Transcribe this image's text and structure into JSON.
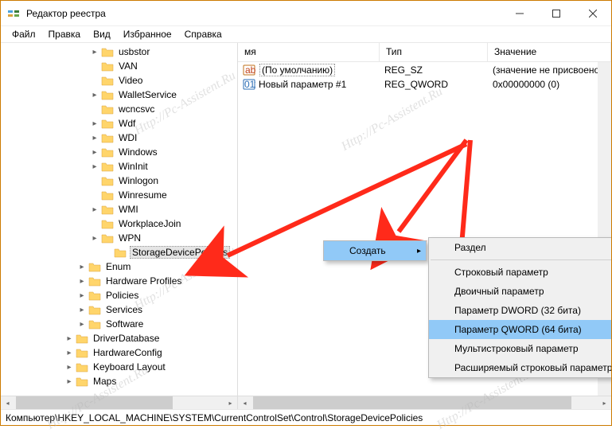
{
  "window": {
    "title": "Редактор реестра"
  },
  "menu": {
    "file": "Файл",
    "edit": "Правка",
    "view": "Вид",
    "favorites": "Избранное",
    "help": "Справка"
  },
  "tree": {
    "items": [
      {
        "indent": 7,
        "exp": "▸",
        "label": "usbstor"
      },
      {
        "indent": 7,
        "exp": "",
        "label": "VAN"
      },
      {
        "indent": 7,
        "exp": "",
        "label": "Video"
      },
      {
        "indent": 7,
        "exp": "▸",
        "label": "WalletService"
      },
      {
        "indent": 7,
        "exp": "",
        "label": "wcncsvc"
      },
      {
        "indent": 7,
        "exp": "▸",
        "label": "Wdf"
      },
      {
        "indent": 7,
        "exp": "▸",
        "label": "WDI"
      },
      {
        "indent": 7,
        "exp": "▸",
        "label": "Windows"
      },
      {
        "indent": 7,
        "exp": "▸",
        "label": "WinInit"
      },
      {
        "indent": 7,
        "exp": "",
        "label": "Winlogon"
      },
      {
        "indent": 7,
        "exp": "",
        "label": "Winresume"
      },
      {
        "indent": 7,
        "exp": "▸",
        "label": "WMI"
      },
      {
        "indent": 7,
        "exp": "",
        "label": "WorkplaceJoin"
      },
      {
        "indent": 7,
        "exp": "▸",
        "label": "WPN"
      },
      {
        "indent": 8,
        "exp": "",
        "label": "StorageDevicePolicies",
        "selected": true
      },
      {
        "indent": 6,
        "exp": "▸",
        "label": "Enum"
      },
      {
        "indent": 6,
        "exp": "▸",
        "label": "Hardware Profiles"
      },
      {
        "indent": 6,
        "exp": "▸",
        "label": "Policies"
      },
      {
        "indent": 6,
        "exp": "▸",
        "label": "Services"
      },
      {
        "indent": 6,
        "exp": "▸",
        "label": "Software"
      },
      {
        "indent": 5,
        "exp": "▸",
        "label": "DriverDatabase"
      },
      {
        "indent": 5,
        "exp": "▸",
        "label": "HardwareConfig"
      },
      {
        "indent": 5,
        "exp": "▸",
        "label": "Keyboard Layout"
      },
      {
        "indent": 5,
        "exp": "▸",
        "label": "Maps"
      }
    ]
  },
  "list": {
    "headers": {
      "name": "мя",
      "type": "Тип",
      "value": "Значение"
    },
    "rows": [
      {
        "icon": "string",
        "name": "(По умолчанию)",
        "framed": true,
        "type": "REG_SZ",
        "value": "(значение не присвоено)"
      },
      {
        "icon": "binary",
        "name": "Новый параметр #1",
        "framed": false,
        "type": "REG_QWORD",
        "value": "0x00000000 (0)"
      }
    ]
  },
  "context": {
    "create": "Создать",
    "submenu": [
      {
        "label": "Раздел"
      },
      {
        "sep": true
      },
      {
        "label": "Строковый параметр"
      },
      {
        "label": "Двоичный параметр"
      },
      {
        "label": "Параметр DWORD (32 бита)"
      },
      {
        "label": "Параметр QWORD (64 бита)",
        "highlight": true
      },
      {
        "label": "Мультистроковый параметр"
      },
      {
        "label": "Расширяемый строковый параметр"
      }
    ]
  },
  "status": {
    "path": "Компьютер\\HKEY_LOCAL_MACHINE\\SYSTEM\\CurrentControlSet\\Control\\StorageDevicePolicies"
  },
  "watermark": "Http://Pc-Assistent.Ru"
}
